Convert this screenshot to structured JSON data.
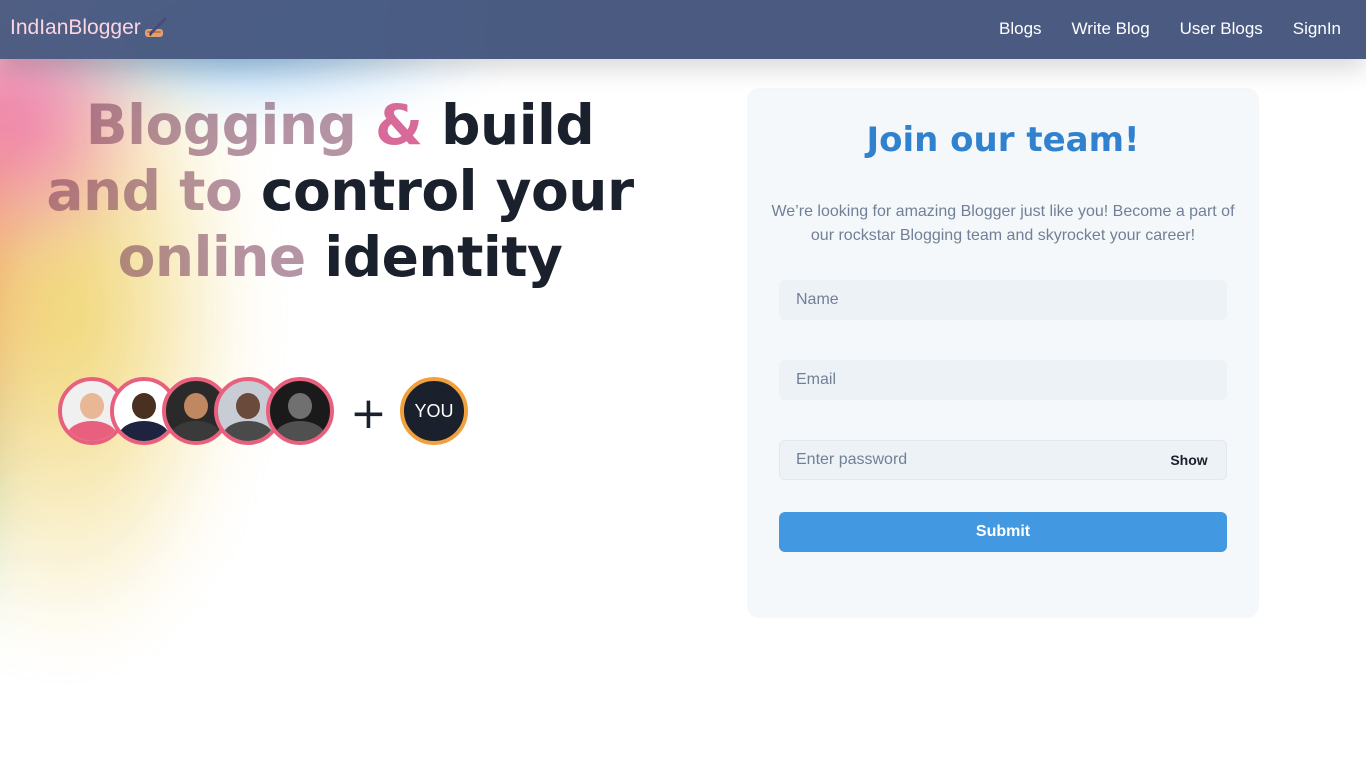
{
  "navbar": {
    "brand": "IndIanBlogger",
    "brand_icon": "writing-hand-icon",
    "links": [
      "Blogs",
      "Write Blog",
      "User Blogs",
      "SignIn"
    ]
  },
  "hero": {
    "line1_part1": "Blogging",
    "line1_amp": "&",
    "line1_part2": "build",
    "line2_part1": "and to",
    "line2_part2": "control your",
    "line3_part1": "online",
    "line3_part2": "identity"
  },
  "team": {
    "avatars": [
      "avatar-1",
      "avatar-2",
      "avatar-3",
      "avatar-4",
      "avatar-5"
    ],
    "plus": "+",
    "you_label": "YOU"
  },
  "form": {
    "title": "Join our team!",
    "description": "We’re looking for amazing Blogger just like you! Become a part of our rockstar Blogging team and skyrocket your career!",
    "name_placeholder": "Name",
    "email_placeholder": "Email",
    "password_placeholder": "Enter password",
    "show_label": "Show",
    "submit_label": "Submit"
  },
  "colors": {
    "navbar": "#4a5a80",
    "accent_blue": "#3182ce",
    "button_blue": "#4299e1",
    "avatar_ring": "#e8607e",
    "you_ring": "#f0a03c"
  }
}
